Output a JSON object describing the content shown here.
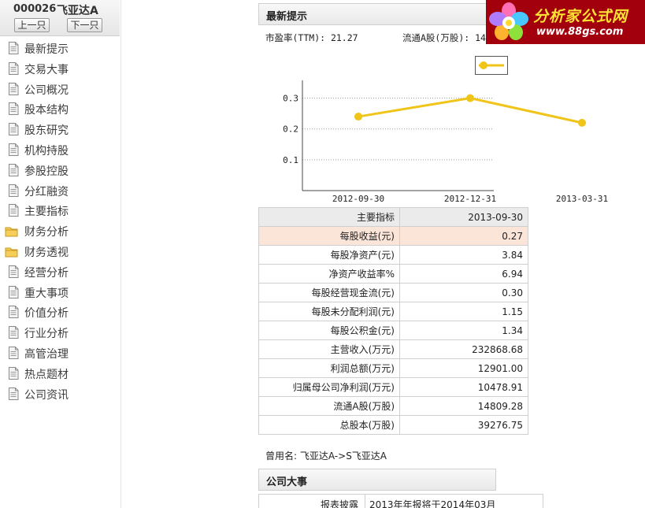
{
  "stock": {
    "code": "000026",
    "name": "飞亚达A"
  },
  "nav": {
    "prev": "上一只",
    "next": "下一只"
  },
  "menu": [
    {
      "label": "最新提示",
      "icon": "document-icon"
    },
    {
      "label": "交易大事",
      "icon": "document-icon"
    },
    {
      "label": "公司概况",
      "icon": "document-icon"
    },
    {
      "label": "股本结构",
      "icon": "document-icon"
    },
    {
      "label": "股东研究",
      "icon": "document-icon"
    },
    {
      "label": "机构持股",
      "icon": "document-icon"
    },
    {
      "label": "参股控股",
      "icon": "document-icon"
    },
    {
      "label": "分红融资",
      "icon": "document-icon"
    },
    {
      "label": "主要指标",
      "icon": "document-icon"
    },
    {
      "label": "财务分析",
      "icon": "folder-icon"
    },
    {
      "label": "财务透视",
      "icon": "folder-icon"
    },
    {
      "label": "经营分析",
      "icon": "document-icon"
    },
    {
      "label": "重大事项",
      "icon": "document-icon"
    },
    {
      "label": "价值分析",
      "icon": "document-icon"
    },
    {
      "label": "行业分析",
      "icon": "document-icon"
    },
    {
      "label": "高管治理",
      "icon": "document-icon"
    },
    {
      "label": "热点题材",
      "icon": "document-icon"
    },
    {
      "label": "公司资讯",
      "icon": "document-icon"
    }
  ],
  "latest": {
    "title": "最新提示",
    "pe": "市盈率(TTM): 21.27",
    "float_shares": "流通A股(万股): 14"
  },
  "chart_data": {
    "type": "line",
    "categories": [
      "2012-09-30",
      "2012-12-31",
      "2013-03-31"
    ],
    "series": [
      {
        "values": [
          0.24,
          0.3,
          0.22
        ]
      }
    ],
    "yticks": [
      "0.3",
      "0.2",
      "0.1"
    ],
    "ylim": [
      0.0,
      0.35
    ],
    "grid": "horizontal dotted",
    "colors": {
      "line": "#f0c419",
      "axis": "#444444",
      "grid": "#999999"
    }
  },
  "indicators": {
    "header": [
      "主要指标",
      "2013-09-30"
    ],
    "rows": [
      {
        "name": "每股收益(元)",
        "value": "0.27"
      },
      {
        "name": "每股净资产(元)",
        "value": "3.84"
      },
      {
        "name": "净资产收益率%",
        "value": "6.94"
      },
      {
        "name": "每股经营现金流(元)",
        "value": "0.30"
      },
      {
        "name": "每股未分配利润(元)",
        "value": "1.15"
      },
      {
        "name": "每股公积金(元)",
        "value": "1.34"
      },
      {
        "name": "主营收入(万元)",
        "value": "232868.68"
      },
      {
        "name": "利润总额(万元)",
        "value": "12901.00"
      },
      {
        "name": "归属母公司净利润(万元)",
        "value": "10478.91"
      },
      {
        "name": "流通A股(万股)",
        "value": "14809.28"
      },
      {
        "name": "总股本(万股)",
        "value": "39276.75"
      }
    ]
  },
  "former_name": "曾用名: 飞亚达A->S飞亚达A",
  "events": {
    "title": "公司大事",
    "row_key": "报表披露",
    "row_value": "2013年年报将于2014年03月"
  },
  "logo": {
    "name": "分析家公式网",
    "url": "www.88gs.com"
  }
}
